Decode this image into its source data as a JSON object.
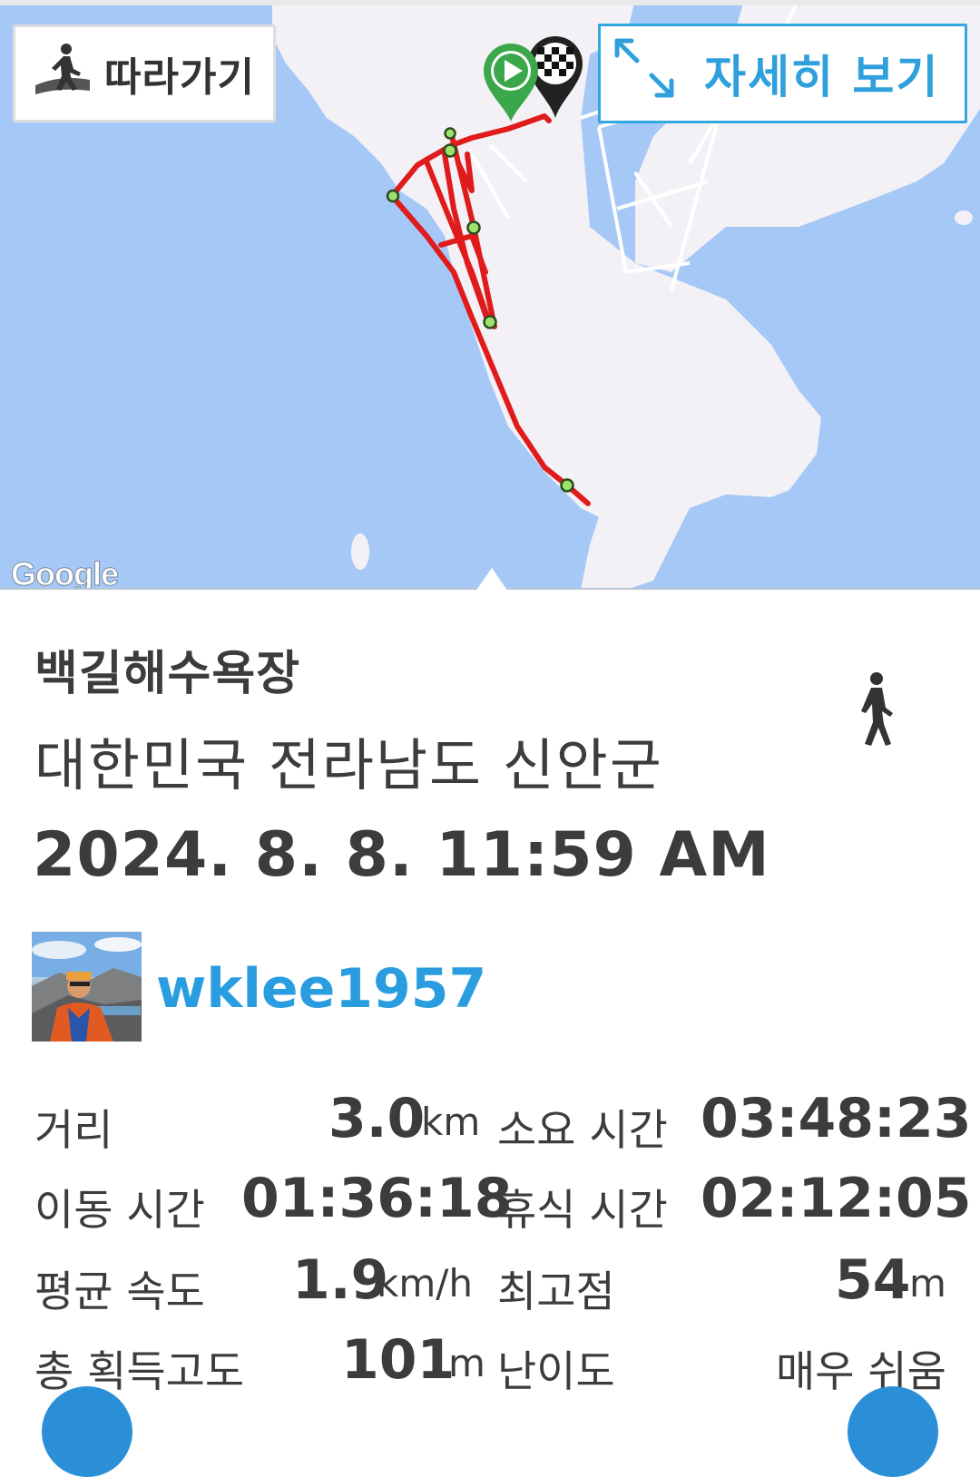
{
  "map": {
    "follow_button_label": "따라가기",
    "detail_button_label": "자세히 보기",
    "attribution": "Google",
    "route_color": "#e01b1b",
    "waypoint_color": "#9be36b",
    "water_color": "#a6c8f7",
    "land_color": "#f3f1f6"
  },
  "track": {
    "place_name": "백길해수욕장",
    "region": "대한민국 전라남도 신안군",
    "datetime": "2024. 8. 8. 11:59 AM",
    "activity_icon": "walking-person-icon"
  },
  "user": {
    "username": "wklee1957",
    "avatar": "user-avatar-photo"
  },
  "stats": {
    "distance": {
      "label": "거리",
      "value": "3.0",
      "unit": "km"
    },
    "duration": {
      "label": "소요 시간",
      "value": "03:48:23"
    },
    "moving_time": {
      "label": "이동 시간",
      "value": "01:36:18"
    },
    "rest_time": {
      "label": "휴식 시간",
      "value": "02:12:05"
    },
    "avg_speed": {
      "label": "평균 속도",
      "value": "1.9",
      "unit": "km/h"
    },
    "max_altitude": {
      "label": "최고점",
      "value": "54",
      "unit": "m"
    },
    "elevation_gain": {
      "label": "총 획득고도",
      "value": "101",
      "unit": "m"
    },
    "difficulty": {
      "label": "난이도",
      "value": "매우 쉬움"
    }
  },
  "accent_color": "#2a9de0"
}
